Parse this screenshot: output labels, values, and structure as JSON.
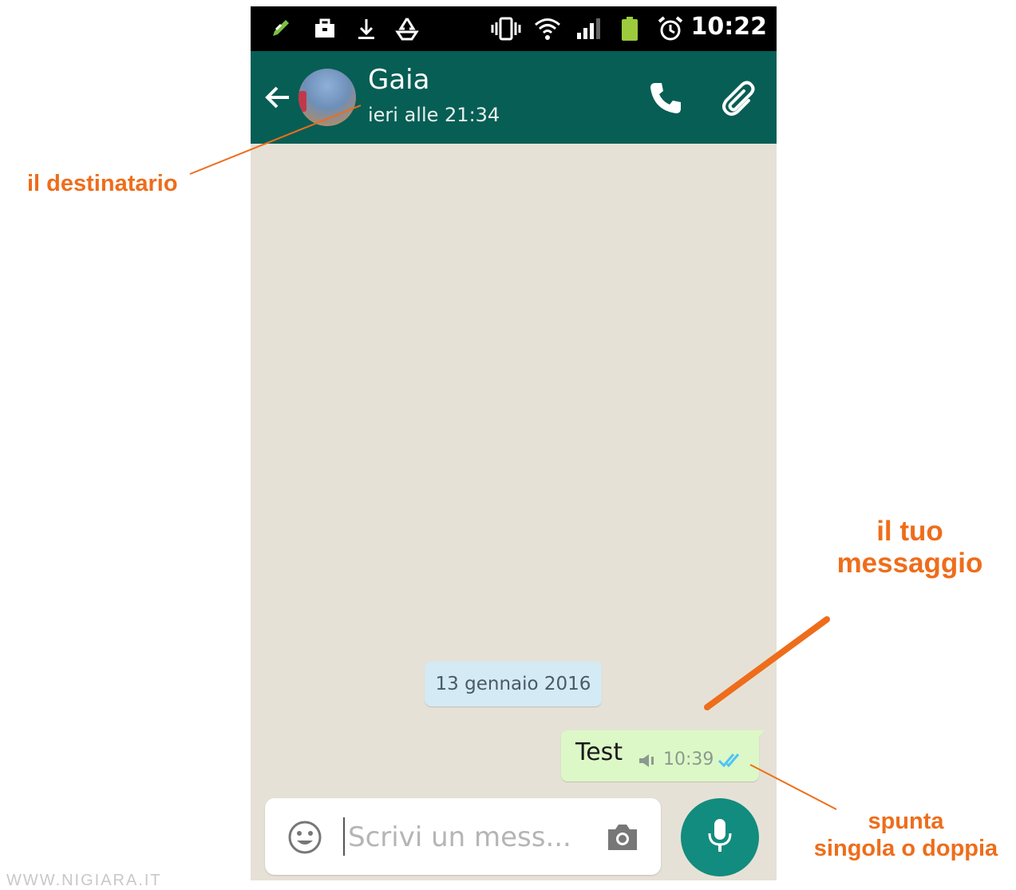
{
  "status_bar": {
    "time": "10:22",
    "icons": [
      "edit-icon",
      "briefcase-icon",
      "download-icon",
      "recycle-icon",
      "vibrate-icon",
      "wifi-icon",
      "signal-icon",
      "battery-icon",
      "alarm-icon"
    ]
  },
  "header": {
    "contact_name": "Gaia",
    "last_seen": "ieri alle 21:34"
  },
  "chat": {
    "date_separator": "13 gennaio 2016",
    "messages": [
      {
        "text": "Test",
        "time": "10:39",
        "status": "double-tick"
      }
    ]
  },
  "input": {
    "placeholder": "Scrivi un mess..."
  },
  "annotations": {
    "recipient": "il destinatario",
    "your_message_line1": "il tuo",
    "your_message_line2": "messaggio",
    "tick_line1": "spunta",
    "tick_line2": "singola o doppia"
  },
  "watermark": "WWW.NIGIARA.IT",
  "colors": {
    "header": "#075e54",
    "bubble_out": "#dcf8c6",
    "date_chip": "#d4eaf4",
    "mic_button": "#128c7e",
    "annotation": "#ee6d1b",
    "tick_read": "#4fc3f7"
  }
}
